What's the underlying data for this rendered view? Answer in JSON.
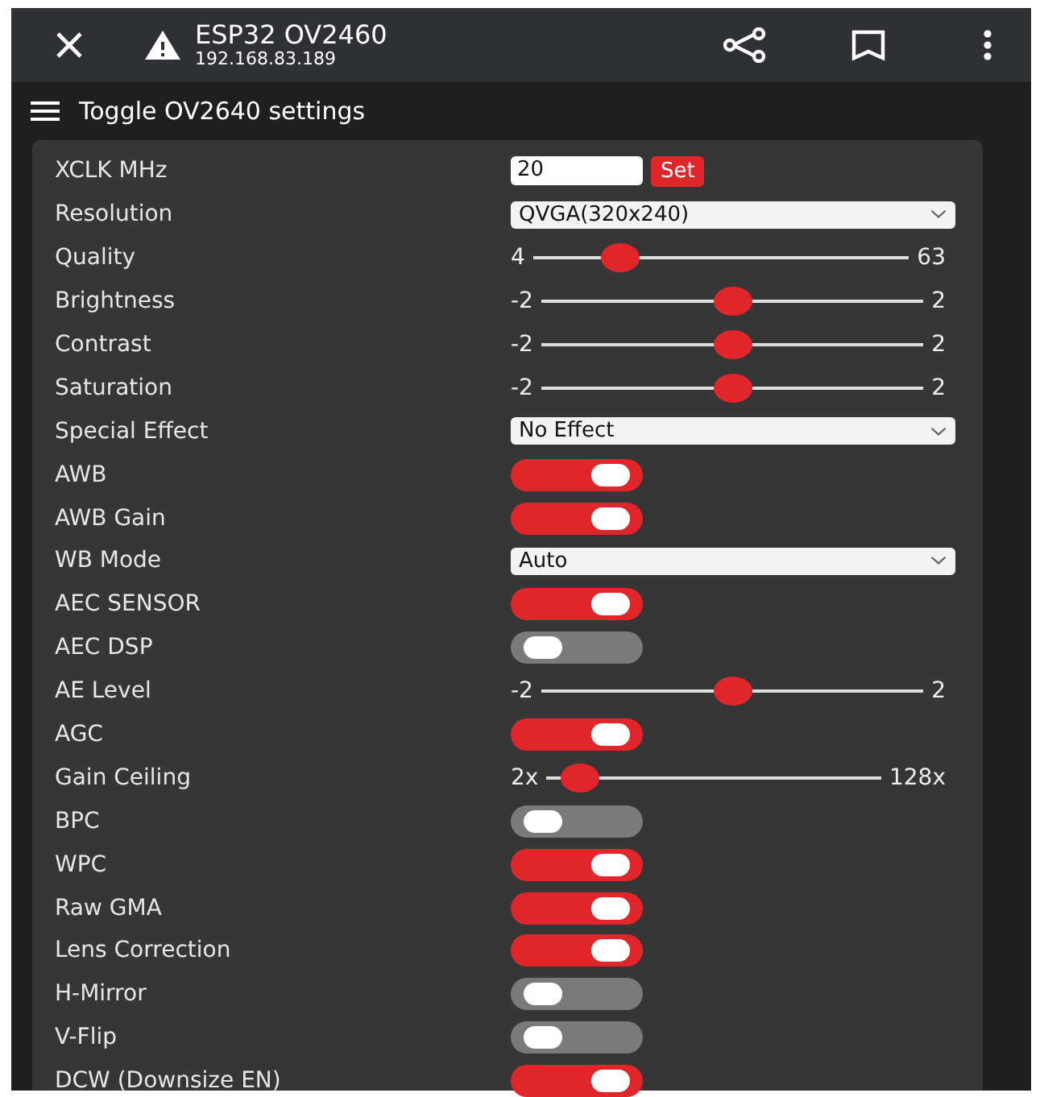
{
  "app_bar": {
    "title": "ESP32 OV2460",
    "subtitle": "192.168.83.189"
  },
  "section": {
    "title": "Toggle OV2640 settings"
  },
  "settings": [
    {
      "kind": "number",
      "label": "XCLK MHz",
      "value": "20",
      "button": "Set"
    },
    {
      "kind": "select",
      "label": "Resolution",
      "value": "QVGA(320x240)"
    },
    {
      "kind": "slider",
      "label": "Quality",
      "min": "4",
      "max": "63",
      "level": 0.2
    },
    {
      "kind": "slider",
      "label": "Brightness",
      "min": "-2",
      "max": "2",
      "level": 0.5
    },
    {
      "kind": "slider",
      "label": "Contrast",
      "min": "-2",
      "max": "2",
      "level": 0.5
    },
    {
      "kind": "slider",
      "label": "Saturation",
      "min": "-2",
      "max": "2",
      "level": 0.5
    },
    {
      "kind": "select",
      "label": "Special Effect",
      "value": "No Effect"
    },
    {
      "kind": "toggle",
      "label": "AWB",
      "on": true
    },
    {
      "kind": "toggle",
      "label": "AWB Gain",
      "on": true
    },
    {
      "kind": "select",
      "label": "WB Mode",
      "value": "Auto"
    },
    {
      "kind": "toggle",
      "label": "AEC SENSOR",
      "on": true
    },
    {
      "kind": "toggle",
      "label": "AEC DSP",
      "on": false
    },
    {
      "kind": "slider",
      "label": "AE Level",
      "min": "-2",
      "max": "2",
      "level": 0.5
    },
    {
      "kind": "toggle",
      "label": "AGC",
      "on": true
    },
    {
      "kind": "slider",
      "label": "Gain Ceiling",
      "min": "2x",
      "max": "128x",
      "level": 0.05
    },
    {
      "kind": "toggle",
      "label": "BPC",
      "on": false
    },
    {
      "kind": "toggle",
      "label": "WPC",
      "on": true
    },
    {
      "kind": "toggle",
      "label": "Raw GMA",
      "on": true
    },
    {
      "kind": "toggle",
      "label": "Lens Correction",
      "on": true
    },
    {
      "kind": "toggle",
      "label": "H-Mirror",
      "on": false
    },
    {
      "kind": "toggle",
      "label": "V-Flip",
      "on": false
    },
    {
      "kind": "toggle",
      "label": "DCW (Downsize EN)",
      "on": true
    }
  ]
}
